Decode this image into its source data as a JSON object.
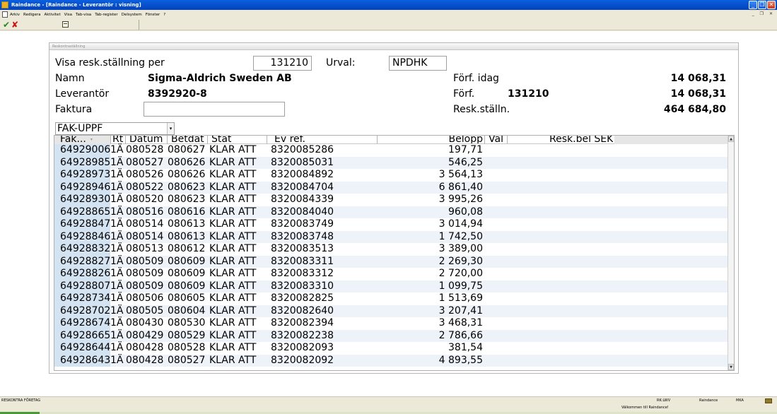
{
  "window": {
    "title": "Raindance - [Raindance - Leverantör : visning]"
  },
  "menu": [
    {
      "label": "Arkiv"
    },
    {
      "label": "Redigera"
    },
    {
      "label": "Aktivitet"
    },
    {
      "label": "Visa"
    },
    {
      "label": "Tab-visa"
    },
    {
      "label": "Tab-register"
    },
    {
      "label": "Delsystem"
    },
    {
      "label": "Fönster"
    },
    {
      "label": "?"
    }
  ],
  "panel": {
    "title": "Reskontraställning",
    "visa_label": "Visa resk.ställning per",
    "visa_value": "131210",
    "urval_label": "Urval:",
    "urval_value": "NPDHK",
    "namn_label": "Namn",
    "namn_value": "Sigma-Aldrich Sweden AB",
    "leverantor_label": "Leverantör",
    "leverantor_value": "8392920-8",
    "faktura_label": "Faktura",
    "faktura_value": "",
    "forf_idag_label": "Förf. idag",
    "forf_idag_value": "14 068,31",
    "forf_label": "Förf.",
    "forf_date": "131210",
    "forf_value": "14 068,31",
    "resk_label": "Resk.ställn.",
    "resk_value": "464 684,80",
    "select_value": "FAK-UPPF"
  },
  "grid": {
    "columns": [
      "Fak...",
      "Rt",
      "Datum",
      "Betdat",
      "Stat",
      "Ev ref.",
      "Belopp",
      "Val",
      "Resk.bel SEK"
    ],
    "rows": [
      [
        "64929006",
        "1Ä",
        "080528",
        "080627",
        "KLAR ATT",
        "8320085286",
        "197,71"
      ],
      [
        "64928985",
        "1Ä",
        "080527",
        "080626",
        "KLAR ATT",
        "8320085031",
        "546,25"
      ],
      [
        "64928973",
        "1Ä",
        "080526",
        "080626",
        "KLAR ATT",
        "8320084892",
        "3 564,13"
      ],
      [
        "64928946",
        "1Ä",
        "080522",
        "080623",
        "KLAR ATT",
        "8320084704",
        "6 861,40"
      ],
      [
        "64928930",
        "1Ä",
        "080520",
        "080623",
        "KLAR ATT",
        "8320084339",
        "3 995,26"
      ],
      [
        "64928865",
        "1Ä",
        "080516",
        "080616",
        "KLAR ATT",
        "8320084040",
        "960,08"
      ],
      [
        "64928847",
        "1Ä",
        "080514",
        "080613",
        "KLAR ATT",
        "8320083749",
        "3 014,94"
      ],
      [
        "64928846",
        "1Ä",
        "080514",
        "080613",
        "KLAR ATT",
        "8320083748",
        "1 742,50"
      ],
      [
        "64928832",
        "1Ä",
        "080513",
        "080612",
        "KLAR ATT",
        "8320083513",
        "3 389,00"
      ],
      [
        "64928827",
        "1Ä",
        "080509",
        "080609",
        "KLAR ATT",
        "8320083311",
        "2 269,30"
      ],
      [
        "64928826",
        "1Ä",
        "080509",
        "080609",
        "KLAR ATT",
        "8320083312",
        "2 720,00"
      ],
      [
        "64928807",
        "1Ä",
        "080509",
        "080609",
        "KLAR ATT",
        "8320083310",
        "1 099,75"
      ],
      [
        "64928734",
        "1Ä",
        "080506",
        "080605",
        "KLAR ATT",
        "8320082825",
        "1 513,69"
      ],
      [
        "64928702",
        "1Ä",
        "080505",
        "080604",
        "KLAR ATT",
        "8320082640",
        "3 207,41"
      ],
      [
        "64928674",
        "1Ä",
        "080430",
        "080530",
        "KLAR ATT",
        "8320082394",
        "3 468,31"
      ],
      [
        "64928665",
        "1Ä",
        "080429",
        "080529",
        "KLAR ATT",
        "8320082238",
        "2 786,66"
      ],
      [
        "64928644",
        "1Ä",
        "080428",
        "080528",
        "KLAR ATT",
        "8320082093",
        "381,54"
      ],
      [
        "64928643",
        "1Ä",
        "080428",
        "080527",
        "KLAR ATT",
        "8320082092",
        "4 893,55"
      ]
    ]
  },
  "status": {
    "left": "RESKONTRA FÖRETAG",
    "rk": "RK:LWV",
    "app": "Raindance",
    "user": "MKA",
    "welcome": "Välkommen till Raindance!"
  }
}
